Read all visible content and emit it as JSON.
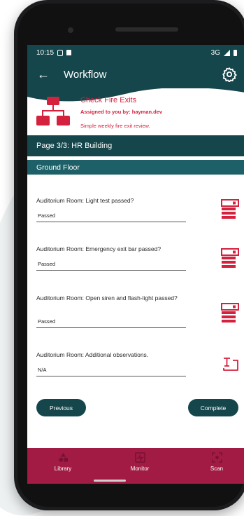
{
  "status_bar": {
    "time": "10:15",
    "network": "3G"
  },
  "app_bar": {
    "title": "Workflow"
  },
  "task_card": {
    "title": "Check Fire Exits",
    "assigned": "Assigned to you by: hayman.dev",
    "description": "Simple weekly fire exit review."
  },
  "page": {
    "label": "Page 3/3: HR Building"
  },
  "section": {
    "label": "Ground Floor"
  },
  "questions": [
    {
      "label": "Auditorium Room: Light test passed?",
      "value": "Passed",
      "icon": "form-select-icon"
    },
    {
      "label": "Auditorium Room: Emergency exit bar passed?",
      "value": "Passed",
      "icon": "form-select-icon"
    },
    {
      "label": "Auditorium Room: Open siren and flash-light passed?",
      "value": "Passed",
      "icon": "form-select-icon"
    },
    {
      "label": "Auditorium Room: Additional observations.",
      "value": "N/A",
      "icon": "text-input-icon"
    }
  ],
  "buttons": {
    "previous": "Previous",
    "complete": "Complete"
  },
  "bottom_nav": [
    {
      "label": "Library",
      "icon": "library-icon"
    },
    {
      "label": "Monitor",
      "icon": "monitor-icon"
    },
    {
      "label": "Scan",
      "icon": "scan-icon"
    }
  ],
  "colors": {
    "primary": "#15464b",
    "accent": "#d4213d",
    "nav": "#a11b45"
  }
}
